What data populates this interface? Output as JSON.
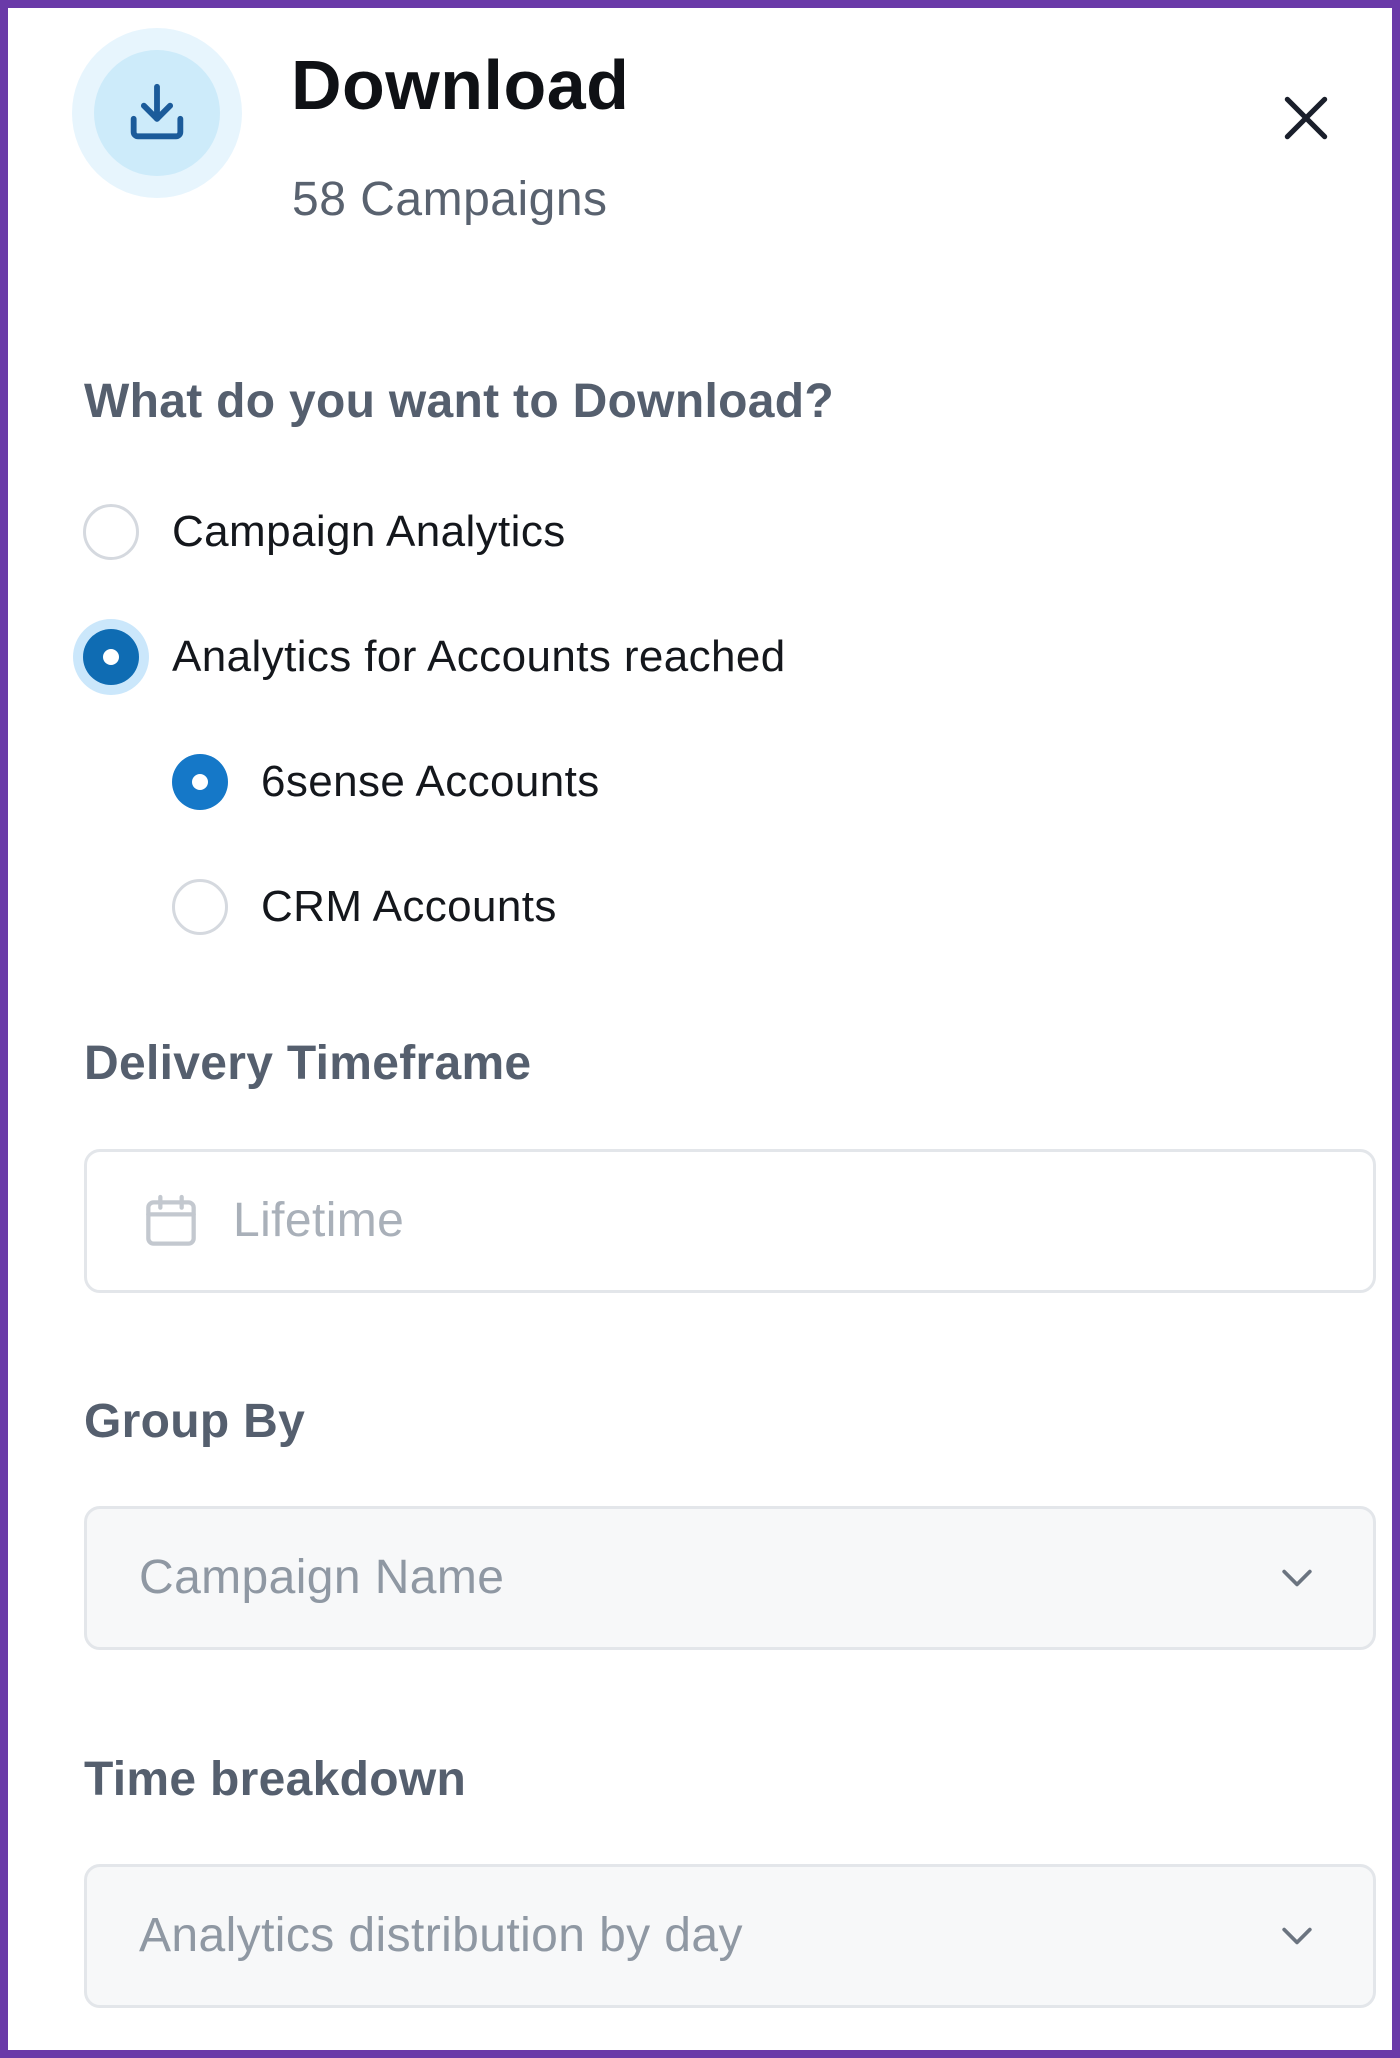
{
  "header": {
    "title": "Download",
    "subtitle": "58 Campaigns",
    "icon": "download-icon",
    "close_icon": "close-icon"
  },
  "download_type": {
    "label": "What do you want to Download?",
    "options": [
      {
        "label": "Campaign Analytics",
        "checked": false
      },
      {
        "label": "Analytics for Accounts reached",
        "checked": true
      }
    ],
    "sub_options": [
      {
        "label": "6sense Accounts",
        "checked": true
      },
      {
        "label": "CRM Accounts",
        "checked": false
      }
    ]
  },
  "delivery_timeframe": {
    "label": "Delivery Timeframe",
    "placeholder": "Lifetime",
    "icon": "calendar-icon"
  },
  "group_by": {
    "label": "Group By",
    "value": "Campaign Name",
    "icon": "chevron-down-icon"
  },
  "time_breakdown": {
    "label": "Time breakdown",
    "value": "Analytics distribution by day",
    "icon": "chevron-down-icon"
  },
  "colors": {
    "frame_border": "#6a3aa8",
    "radio_checked": "#0f6cb3",
    "icon_circle": "#cdebfa",
    "icon_stroke": "#1b5b9a",
    "label_text": "#555f6e"
  }
}
